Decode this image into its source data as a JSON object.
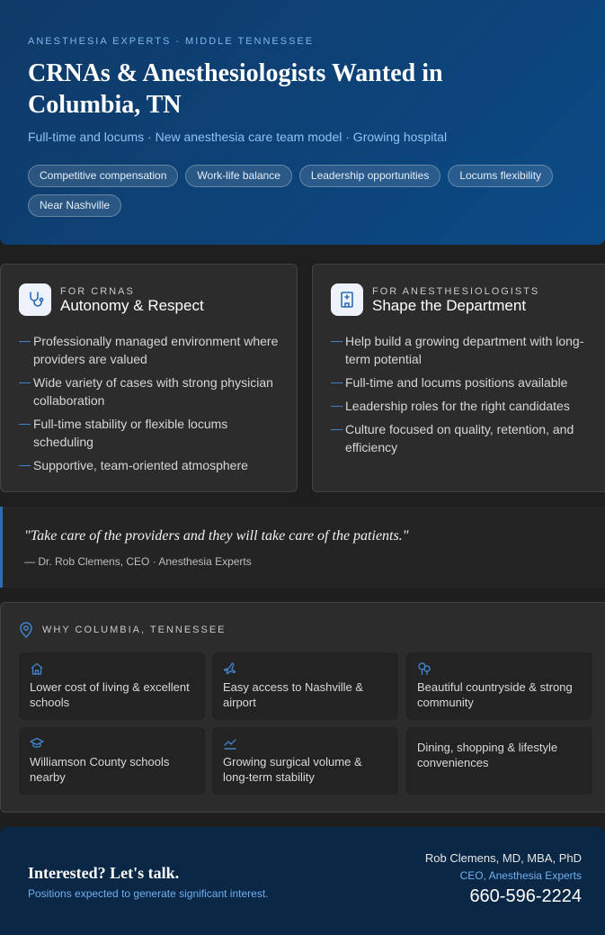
{
  "hero": {
    "eyebrow": "ANESTHESIA EXPERTS · MIDDLE TENNESSEE",
    "headline": "CRNAs & Anesthesiologists Wanted in Columbia, TN",
    "subhead": "Full-time and locums · New anesthesia care team model · Growing hospital",
    "chips": [
      "Competitive compensation",
      "Work-life balance",
      "Leadership opportunities",
      "Locums flexibility",
      "Near Nashville"
    ]
  },
  "crna_card": {
    "icon": "stethoscope-icon",
    "kicker": "FOR CRNAS",
    "title": "Autonomy & Respect",
    "items": [
      "Professionally managed environment where providers are valued",
      "Wide variety of cases with strong physician collaboration",
      "Full-time stability or flexible locums scheduling",
      "Supportive, team-oriented atmosphere"
    ]
  },
  "anes_card": {
    "icon": "hospital-icon",
    "kicker": "FOR ANESTHESIOLOGISTS",
    "title": "Shape the Department",
    "items": [
      "Help build a growing department with long-term potential",
      "Full-time and locums positions available",
      "Leadership roles for the right candidates",
      "Culture focused on quality, retention, and efficiency"
    ]
  },
  "quote": {
    "text": "\"Take care of the providers and they will take care of the patients.\"",
    "attribution": "— Dr. Rob Clemens, CEO · Anesthesia Experts"
  },
  "why": {
    "heading": "WHY COLUMBIA, TENNESSEE",
    "tiles": [
      {
        "icon": "home-icon",
        "text": "Lower cost of living & excellent schools"
      },
      {
        "icon": "plane-icon",
        "text": "Easy access to Nashville & airport"
      },
      {
        "icon": "trees-icon",
        "text": "Beautiful countryside & strong community"
      },
      {
        "icon": "graduation-cap-icon",
        "text": "Williamson County schools nearby"
      },
      {
        "icon": "trend-chart-icon",
        "text": "Growing surgical volume & long-term stability"
      },
      {
        "icon": "",
        "text": "Dining, shopping & lifestyle conveniences"
      }
    ]
  },
  "footer": {
    "cta_title": "Interested? Let's talk.",
    "cta_sub": "Positions expected to generate significant interest.",
    "contact_name": "Rob Clemens, MD, MBA, PhD",
    "contact_role": "CEO, Anesthesia Experts",
    "phone": "660-596-2224"
  },
  "colors": {
    "hero": "#0b4a86",
    "accent": "#3f82c7",
    "footer": "#0a2746",
    "card": "#2c2c2c"
  }
}
